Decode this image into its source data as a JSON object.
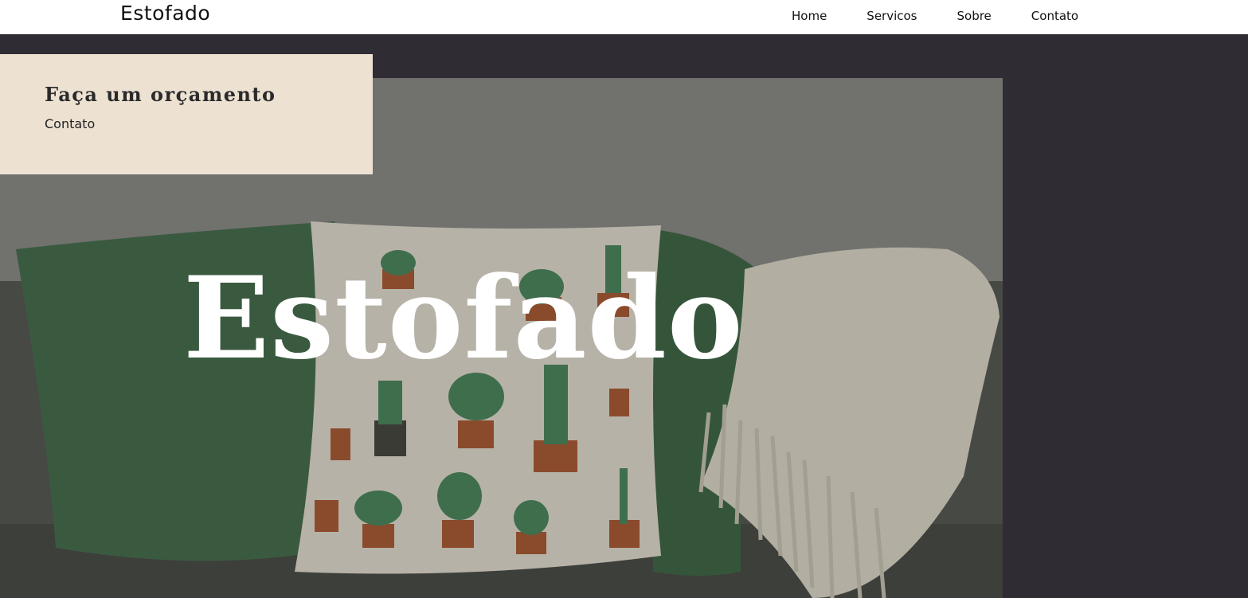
{
  "navbar": {
    "brand": "Estofado",
    "links": [
      {
        "label": "Home"
      },
      {
        "label": "Servicos"
      },
      {
        "label": "Sobre"
      },
      {
        "label": "Contato"
      }
    ]
  },
  "quote_card": {
    "title": "Faça um orçamento",
    "link_label": "Contato"
  },
  "hero": {
    "title": "Estofado",
    "image_subject": "sofa with green velvet pillows, cactus-print pillow and knitted throw blanket"
  },
  "colors": {
    "page_background": "#2f2d33",
    "navbar_background": "#ffffff",
    "card_background": "#ede2d2",
    "hero_text": "#ffffff"
  }
}
